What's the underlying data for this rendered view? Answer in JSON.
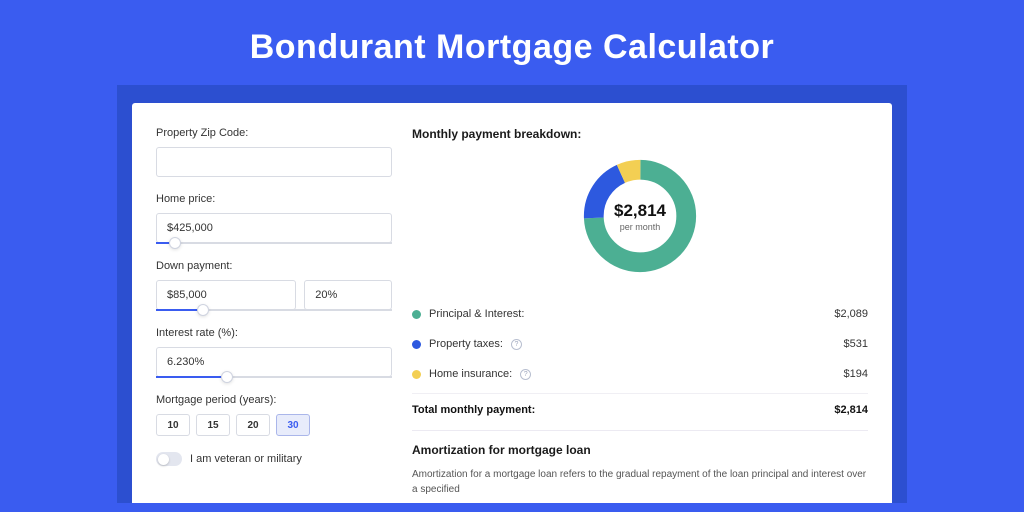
{
  "title": "Bondurant Mortgage Calculator",
  "form": {
    "zip": {
      "label": "Property Zip Code:",
      "value": ""
    },
    "home_price": {
      "label": "Home price:",
      "value": "$425,000",
      "slider_pct": 8
    },
    "down_payment": {
      "label": "Down payment:",
      "value": "$85,000",
      "pct_value": "20%",
      "slider_pct": 20
    },
    "interest_rate": {
      "label": "Interest rate (%):",
      "value": "6.230%",
      "slider_pct": 30
    },
    "period": {
      "label": "Mortgage period (years):",
      "options": [
        "10",
        "15",
        "20",
        "30"
      ],
      "selected": "30"
    },
    "veteran": {
      "label": "I am veteran or military",
      "on": false
    }
  },
  "breakdown": {
    "title": "Monthly payment breakdown:",
    "center_amount": "$2,814",
    "center_sub": "per month",
    "items": [
      {
        "label": "Principal & Interest:",
        "value": "$2,089",
        "color": "green",
        "info": false
      },
      {
        "label": "Property taxes:",
        "value": "$531",
        "color": "blue",
        "info": true
      },
      {
        "label": "Home insurance:",
        "value": "$194",
        "color": "yellow",
        "info": true
      }
    ],
    "total_label": "Total monthly payment:",
    "total_value": "$2,814"
  },
  "amortization": {
    "title": "Amortization for mortgage loan",
    "text": "Amortization for a mortgage loan refers to the gradual repayment of the loan principal and interest over a specified"
  },
  "chart_data": {
    "type": "pie",
    "title": "Monthly payment breakdown",
    "series": [
      {
        "name": "Principal & Interest",
        "value": 2089,
        "color": "#4caf93"
      },
      {
        "name": "Property taxes",
        "value": 531,
        "color": "#2d59df"
      },
      {
        "name": "Home insurance",
        "value": 194,
        "color": "#f3cf53"
      }
    ],
    "total": 2814,
    "center_label": "$2,814 per month"
  }
}
